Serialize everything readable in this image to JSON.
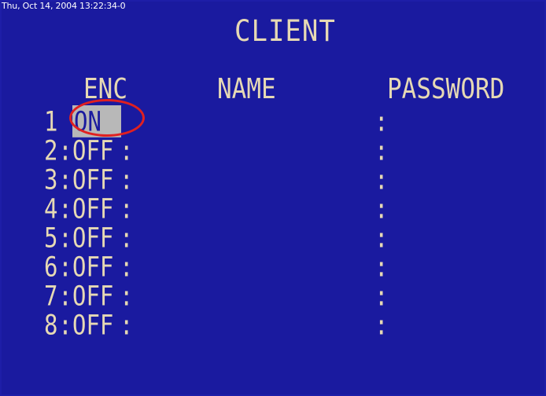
{
  "timestamp": "Thu, Oct 14, 2004 13:22:34-0",
  "title": "CLIENT",
  "columns": {
    "enc": "ENC",
    "name": "NAME",
    "password": "PASSWORD"
  },
  "rows": [
    {
      "num": "1",
      "sep": "",
      "value": "ON",
      "sep2": "",
      "name": "",
      "pass_sep": ":",
      "password": ""
    },
    {
      "num": "2",
      "sep": ":",
      "value": "OFF",
      "sep2": ":",
      "name": "",
      "pass_sep": ":",
      "password": ""
    },
    {
      "num": "3",
      "sep": ":",
      "value": "OFF",
      "sep2": ":",
      "name": "",
      "pass_sep": ":",
      "password": ""
    },
    {
      "num": "4",
      "sep": ":",
      "value": "OFF",
      "sep2": ":",
      "name": "",
      "pass_sep": ":",
      "password": ""
    },
    {
      "num": "5",
      "sep": ":",
      "value": "OFF",
      "sep2": ":",
      "name": "",
      "pass_sep": ":",
      "password": ""
    },
    {
      "num": "6",
      "sep": ":",
      "value": "OFF",
      "sep2": ":",
      "name": "",
      "pass_sep": ":",
      "password": ""
    },
    {
      "num": "7",
      "sep": ":",
      "value": "OFF",
      "sep2": ":",
      "name": "",
      "pass_sep": ":",
      "password": ""
    },
    {
      "num": "8",
      "sep": ":",
      "value": "OFF",
      "sep2": ":",
      "name": "",
      "pass_sep": ":",
      "password": ""
    }
  ],
  "colors": {
    "background": "#1a1a9f",
    "text": "#e6d9b4",
    "selection": "#b8b8b8",
    "annotation": "#e02020"
  }
}
